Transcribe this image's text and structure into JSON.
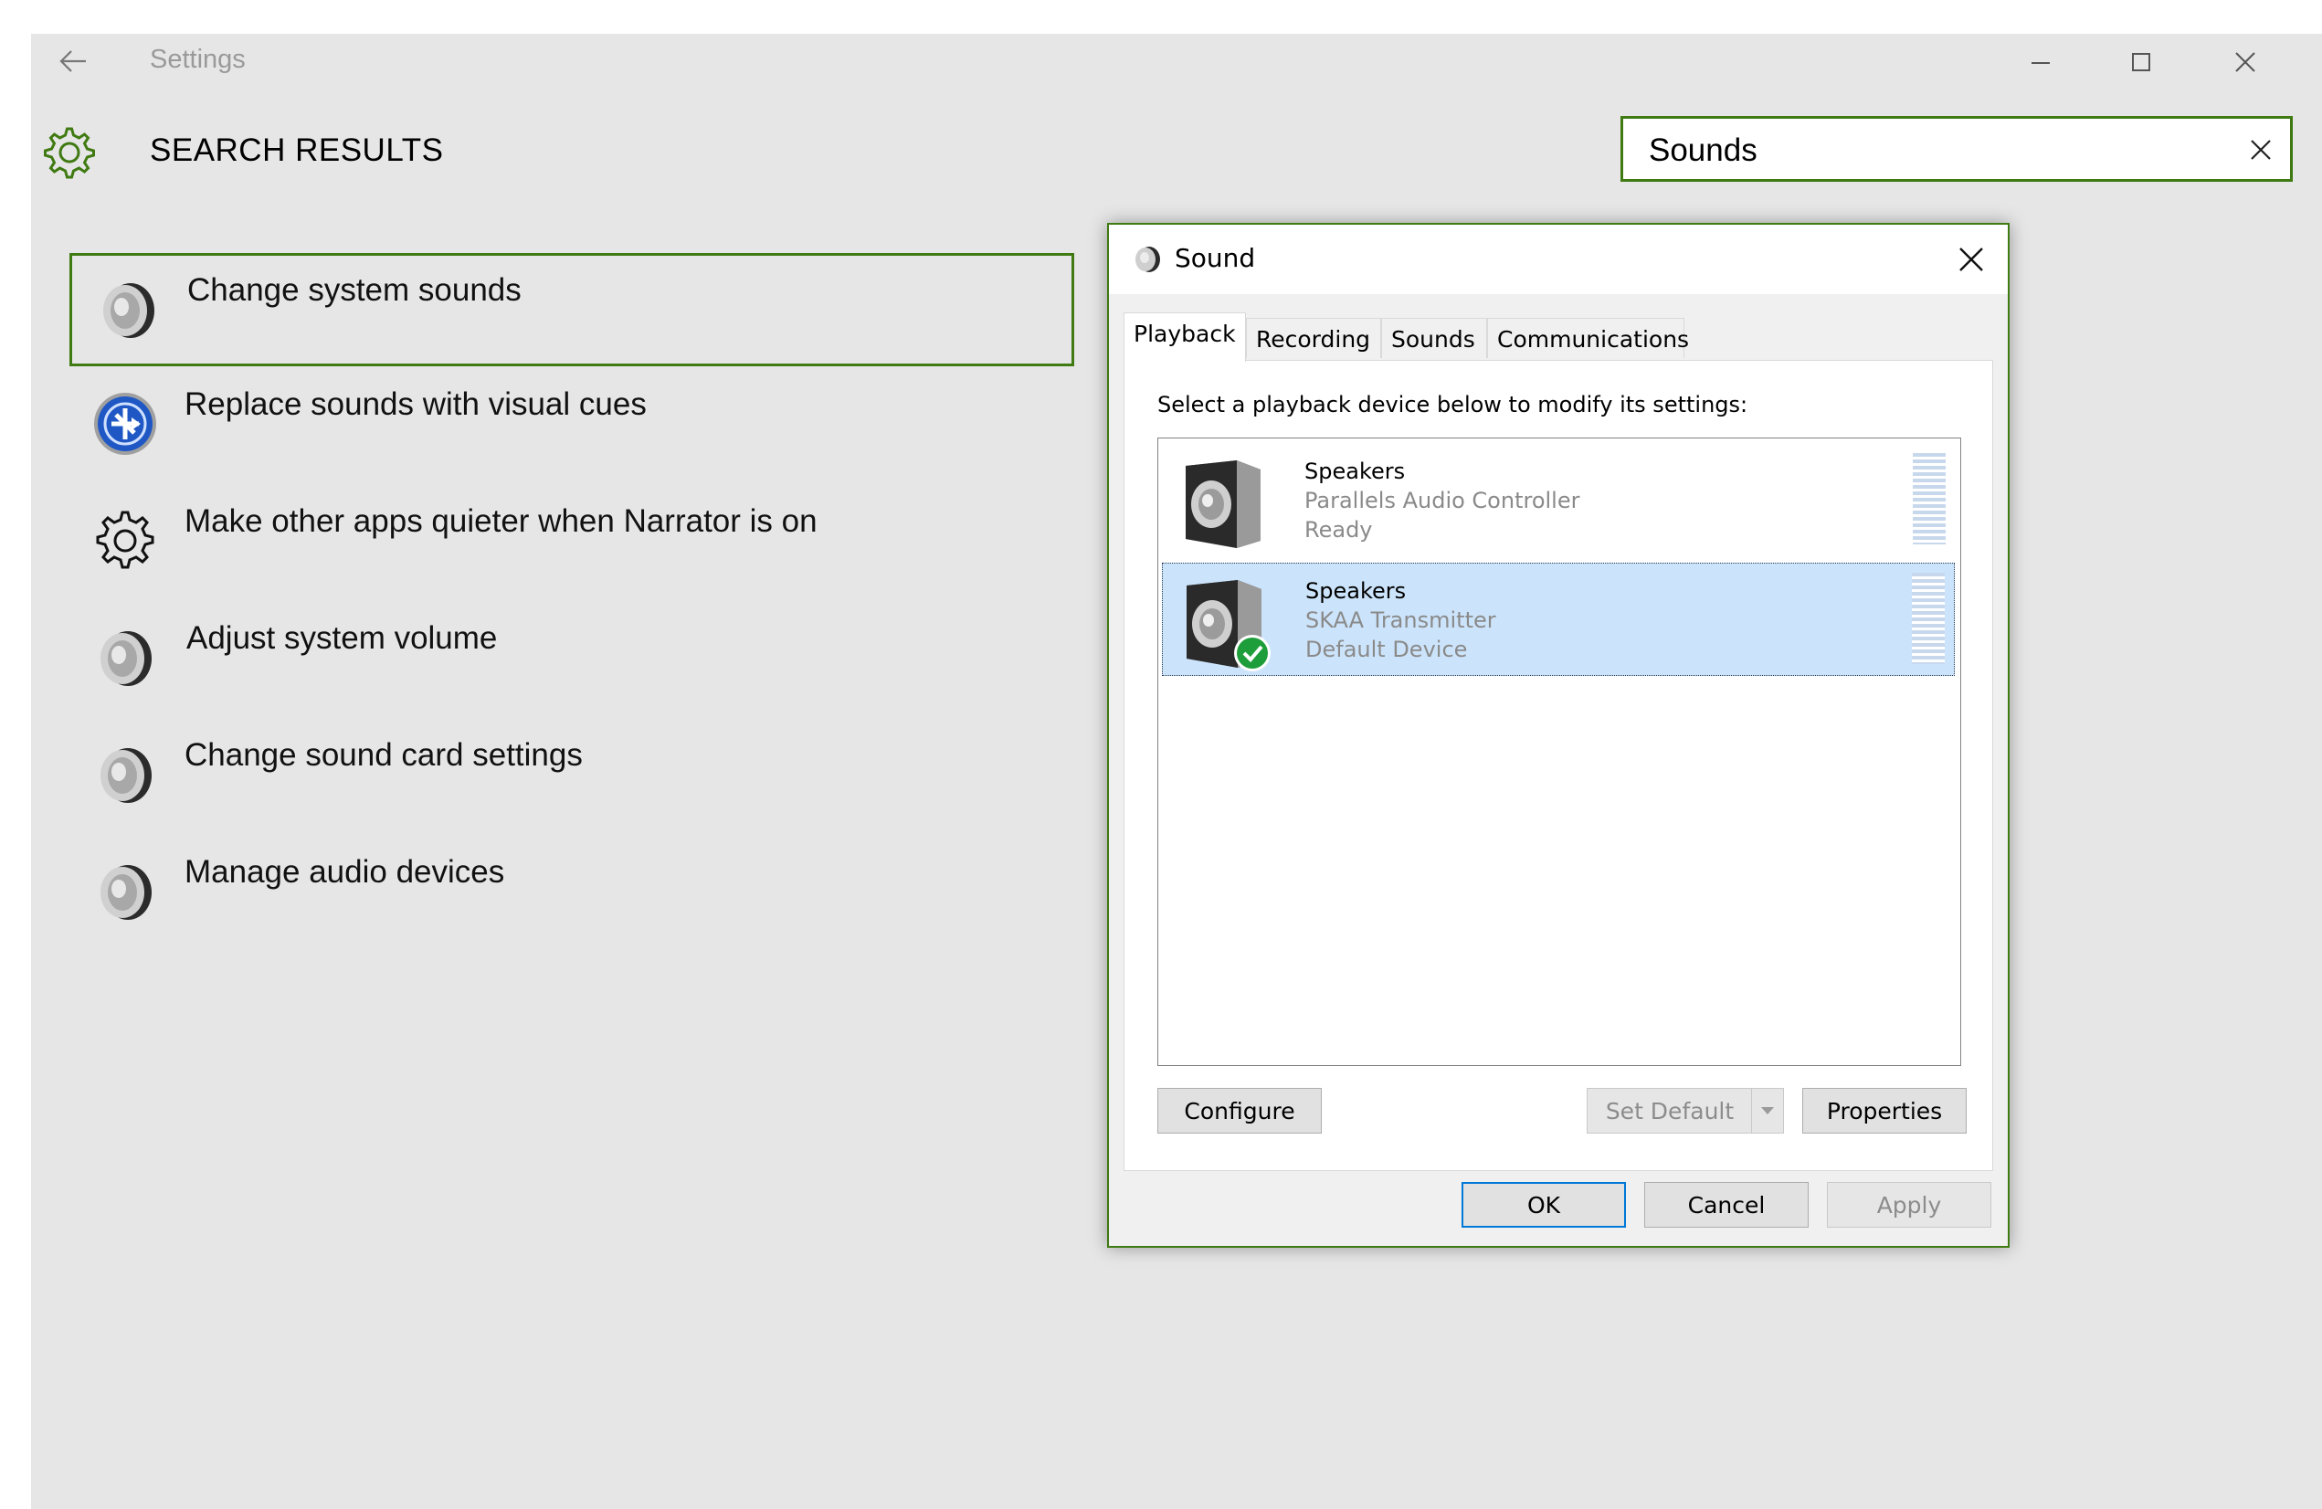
{
  "window": {
    "title": "Settings",
    "header": "SEARCH RESULTS"
  },
  "search": {
    "value": "Sounds",
    "placeholder": ""
  },
  "results": [
    {
      "label": "Change system sounds",
      "icon": "speaker-icon"
    },
    {
      "label": "Replace sounds with visual cues",
      "icon": "ease-of-access-icon"
    },
    {
      "label": "Make other apps quieter when Narrator is on",
      "icon": "gear-icon"
    },
    {
      "label": "Adjust system volume",
      "icon": "speaker-icon"
    },
    {
      "label": "Change sound card settings",
      "icon": "speaker-icon"
    },
    {
      "label": "Manage audio devices",
      "icon": "speaker-icon"
    }
  ],
  "dialog": {
    "title": "Sound",
    "tabs": [
      "Playback",
      "Recording",
      "Sounds",
      "Communications"
    ],
    "instruction": "Select a playback device below to modify its settings:",
    "devices": [
      {
        "name": "Speakers",
        "description": "Parallels Audio Controller",
        "status": "Ready"
      },
      {
        "name": "Speakers",
        "description": "SKAA Transmitter",
        "status": "Default Device"
      }
    ],
    "buttons": {
      "configure": "Configure",
      "set_default": "Set Default",
      "properties": "Properties",
      "ok": "OK",
      "cancel": "Cancel",
      "apply": "Apply"
    }
  },
  "colors": {
    "accent_border": "#3f7a12",
    "selection": "#cce4fb",
    "default_button": "#0078d7",
    "check_badge": "#1e9e3a"
  }
}
